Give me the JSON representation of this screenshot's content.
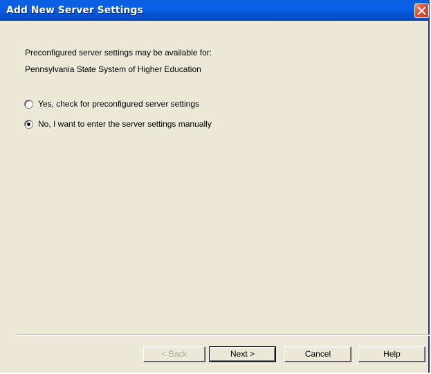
{
  "window": {
    "title": "Add New Server Settings"
  },
  "intro": {
    "line1": "Preconfigured server settings may be available for:",
    "line2": "Pennsylvania State System of Higher Education"
  },
  "options": [
    {
      "label": "Yes, check for preconfigured server settings",
      "selected": false
    },
    {
      "label": "No, I want to enter the server settings manually",
      "selected": true
    }
  ],
  "buttons": {
    "back": "< Back",
    "next": "Next >",
    "cancel": "Cancel",
    "help": "Help"
  },
  "colors": {
    "titlebar": "#0a5ede",
    "dialog_background": "#ece9d8",
    "close_button": "#d9553a"
  },
  "icons": {
    "close": "close-icon"
  }
}
